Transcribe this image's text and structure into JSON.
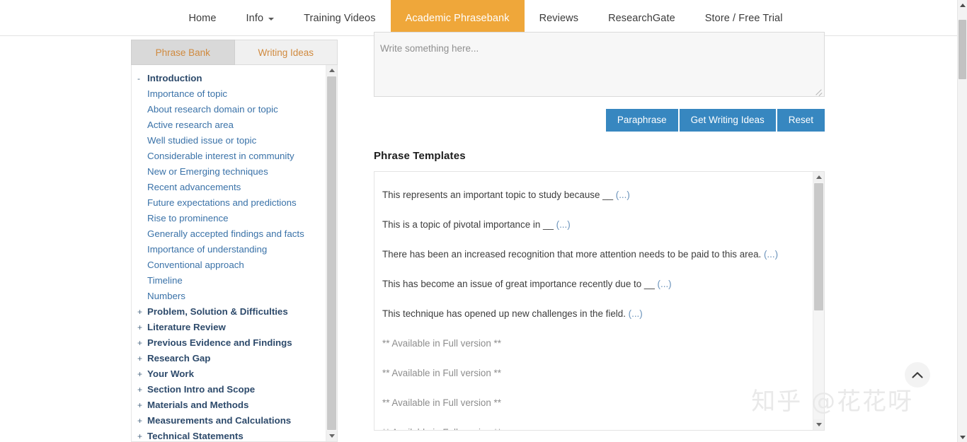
{
  "topnav": {
    "items": [
      {
        "label": "Home",
        "active": false,
        "caret": false
      },
      {
        "label": "Info",
        "active": false,
        "caret": true
      },
      {
        "label": "Training Videos",
        "active": false,
        "caret": false
      },
      {
        "label": "Academic Phrasebank",
        "active": true,
        "caret": false
      },
      {
        "label": "Reviews",
        "active": false,
        "caret": false
      },
      {
        "label": "ResearchGate",
        "active": false,
        "caret": false
      },
      {
        "label": "Store / Free Trial",
        "active": false,
        "caret": false
      }
    ],
    "active_color": "#efa73a"
  },
  "sidebar": {
    "tabs": [
      {
        "label": "Phrase Bank",
        "active": true
      },
      {
        "label": "Writing Ideas",
        "active": false
      }
    ],
    "tree": [
      {
        "marker": "-",
        "label": "Introduction",
        "type": "parent"
      },
      {
        "marker": "",
        "label": "Importance of topic",
        "type": "child"
      },
      {
        "marker": "",
        "label": "About research domain or topic",
        "type": "child"
      },
      {
        "marker": "",
        "label": "Active research area",
        "type": "child"
      },
      {
        "marker": "",
        "label": "Well studied issue or topic",
        "type": "child"
      },
      {
        "marker": "",
        "label": "Considerable interest in community",
        "type": "child"
      },
      {
        "marker": "",
        "label": "New or Emerging techniques",
        "type": "child"
      },
      {
        "marker": "",
        "label": "Recent advancements",
        "type": "child"
      },
      {
        "marker": "",
        "label": "Future expectations and predictions",
        "type": "child"
      },
      {
        "marker": "",
        "label": "Rise to prominence",
        "type": "child"
      },
      {
        "marker": "",
        "label": "Generally accepted findings and facts",
        "type": "child"
      },
      {
        "marker": "",
        "label": "Importance of understanding",
        "type": "child"
      },
      {
        "marker": "",
        "label": "Conventional approach",
        "type": "child"
      },
      {
        "marker": "",
        "label": "Timeline",
        "type": "child"
      },
      {
        "marker": "",
        "label": "Numbers",
        "type": "child"
      },
      {
        "marker": "+",
        "label": "Problem, Solution & Difficulties",
        "type": "parent"
      },
      {
        "marker": "+",
        "label": "Literature Review",
        "type": "parent"
      },
      {
        "marker": "+",
        "label": "Previous Evidence and Findings",
        "type": "parent"
      },
      {
        "marker": "+",
        "label": "Research Gap",
        "type": "parent"
      },
      {
        "marker": "+",
        "label": "Your Work",
        "type": "parent"
      },
      {
        "marker": "+",
        "label": "Section Intro and Scope",
        "type": "parent"
      },
      {
        "marker": "+",
        "label": "Materials and Methods",
        "type": "parent"
      },
      {
        "marker": "+",
        "label": "Measurements and Calculations",
        "type": "parent"
      },
      {
        "marker": "+",
        "label": "Technical Statements",
        "type": "parent"
      }
    ]
  },
  "composer": {
    "placeholder": "Write something here...",
    "value": ""
  },
  "actions": {
    "paraphrase": "Paraphrase",
    "get_writing_ideas": "Get Writing Ideas",
    "reset": "Reset",
    "button_color": "#3787c0"
  },
  "templates": {
    "title": "Phrase Templates",
    "items": [
      {
        "text": "This represents an important topic to study because __",
        "ellipsis": "(...)",
        "locked": false
      },
      {
        "text": "This is a topic of pivotal importance in __",
        "ellipsis": "(...)",
        "locked": false
      },
      {
        "text": "There has been an increased recognition that more attention needs to be paid to this area.",
        "ellipsis": "(...)",
        "locked": false
      },
      {
        "text": "This has become an issue of great importance recently due to __",
        "ellipsis": "(...)",
        "locked": false
      },
      {
        "text": "This technique has opened up new challenges in the field.",
        "ellipsis": "(...)",
        "locked": false
      },
      {
        "text": "** Available in Full version **",
        "ellipsis": "",
        "locked": true
      },
      {
        "text": "** Available in Full version **",
        "ellipsis": "",
        "locked": true
      },
      {
        "text": "** Available in Full version **",
        "ellipsis": "",
        "locked": true
      },
      {
        "text": "** Available in Full version **",
        "ellipsis": "",
        "locked": true
      }
    ]
  },
  "watermark": {
    "text": "知乎 @花花呀"
  }
}
